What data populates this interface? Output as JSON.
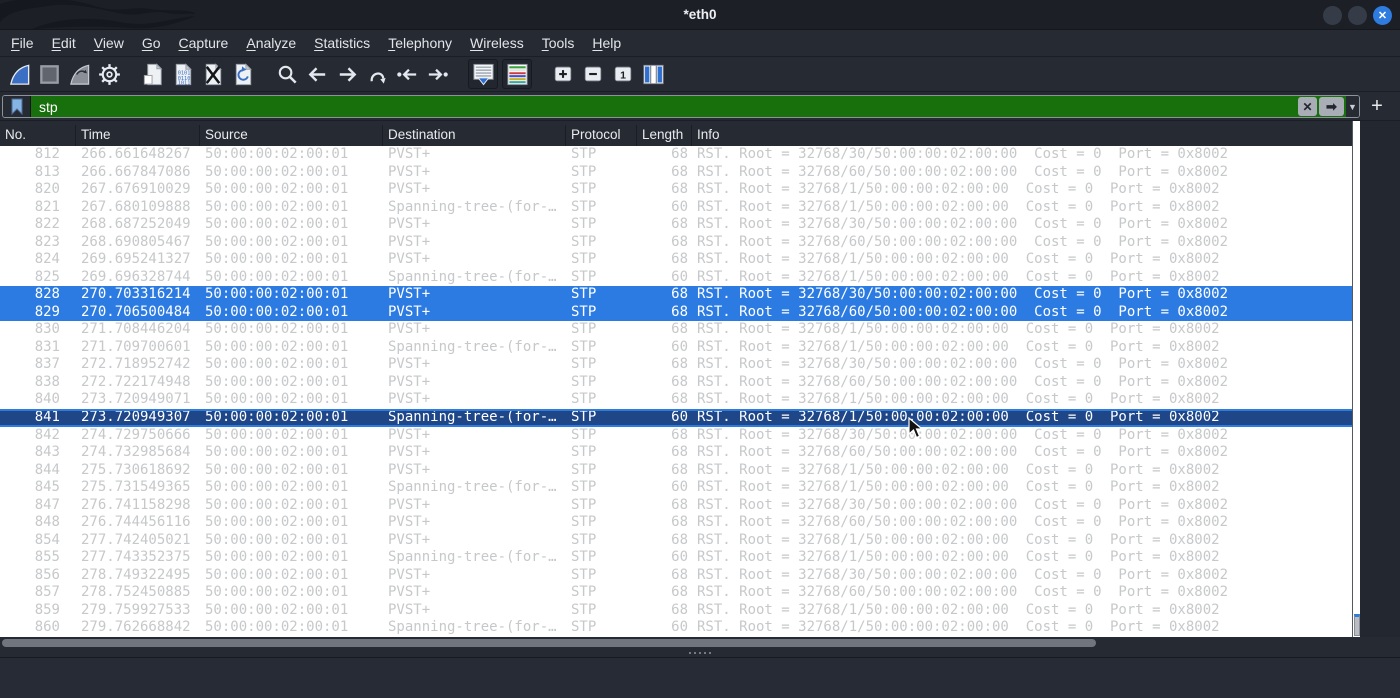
{
  "window": {
    "title": "*eth0"
  },
  "titlebar": {
    "close_glyph": "✕",
    "buttons": [
      "minimize",
      "maximize",
      "close"
    ]
  },
  "menu": {
    "items": [
      "File",
      "Edit",
      "View",
      "Go",
      "Capture",
      "Analyze",
      "Statistics",
      "Telephony",
      "Wireless",
      "Tools",
      "Help"
    ]
  },
  "toolbar": {
    "groups": [
      [
        "start-capture",
        "stop-capture",
        "restart-capture",
        "capture-options"
      ],
      [
        "open-capture-file",
        "save-capture-file",
        "close-capture-file",
        "reload-capture-file"
      ],
      [
        "find-packet",
        "go-back",
        "go-forward",
        "go-to-packet",
        "go-first-packet",
        "go-last-packet"
      ],
      [
        "auto-scroll",
        "colorize-packets"
      ],
      [
        "zoom-in",
        "zoom-out",
        "zoom-original",
        "resize-columns"
      ]
    ]
  },
  "filter": {
    "value": "stp",
    "state": "valid",
    "field_color": "#17700c",
    "clear_glyph": "✕",
    "apply_glyph": "➡",
    "caret_glyph": "▼",
    "add_label": "+"
  },
  "packet_table": {
    "columns": [
      {
        "key": "no",
        "label": "No.",
        "width": 76,
        "align": "right"
      },
      {
        "key": "time",
        "label": "Time",
        "width": 124,
        "align": "left"
      },
      {
        "key": "source",
        "label": "Source",
        "width": 183,
        "align": "left"
      },
      {
        "key": "destination",
        "label": "Destination",
        "width": 183,
        "align": "left"
      },
      {
        "key": "protocol",
        "label": "Protocol",
        "width": 71,
        "align": "left"
      },
      {
        "key": "length",
        "label": "Length",
        "width": 55,
        "align": "right"
      },
      {
        "key": "info",
        "label": "Info",
        "width": null,
        "align": "left"
      }
    ],
    "rows": [
      {
        "state": "normal",
        "no": "812",
        "time": "266.661648267",
        "source": "50:00:00:02:00:01",
        "destination": "PVST+",
        "protocol": "STP",
        "length": "68",
        "info": "RST. Root = 32768/30/50:00:00:02:00:00  Cost = 0  Port = 0x8002"
      },
      {
        "state": "normal",
        "no": "813",
        "time": "266.667847086",
        "source": "50:00:00:02:00:01",
        "destination": "PVST+",
        "protocol": "STP",
        "length": "68",
        "info": "RST. Root = 32768/60/50:00:00:02:00:00  Cost = 0  Port = 0x8002"
      },
      {
        "state": "normal",
        "no": "820",
        "time": "267.676910029",
        "source": "50:00:00:02:00:01",
        "destination": "PVST+",
        "protocol": "STP",
        "length": "68",
        "info": "RST. Root = 32768/1/50:00:00:02:00:00  Cost = 0  Port = 0x8002"
      },
      {
        "state": "normal",
        "no": "821",
        "time": "267.680109888",
        "source": "50:00:00:02:00:01",
        "destination": "Spanning-tree-(for-…",
        "protocol": "STP",
        "length": "60",
        "info": "RST. Root = 32768/1/50:00:00:02:00:00  Cost = 0  Port = 0x8002"
      },
      {
        "state": "normal",
        "no": "822",
        "time": "268.687252049",
        "source": "50:00:00:02:00:01",
        "destination": "PVST+",
        "protocol": "STP",
        "length": "68",
        "info": "RST. Root = 32768/30/50:00:00:02:00:00  Cost = 0  Port = 0x8002"
      },
      {
        "state": "normal",
        "no": "823",
        "time": "268.690805467",
        "source": "50:00:00:02:00:01",
        "destination": "PVST+",
        "protocol": "STP",
        "length": "68",
        "info": "RST. Root = 32768/60/50:00:00:02:00:00  Cost = 0  Port = 0x8002"
      },
      {
        "state": "normal",
        "no": "824",
        "time": "269.695241327",
        "source": "50:00:00:02:00:01",
        "destination": "PVST+",
        "protocol": "STP",
        "length": "68",
        "info": "RST. Root = 32768/1/50:00:00:02:00:00  Cost = 0  Port = 0x8002"
      },
      {
        "state": "normal",
        "no": "825",
        "time": "269.696328744",
        "source": "50:00:00:02:00:01",
        "destination": "Spanning-tree-(for-…",
        "protocol": "STP",
        "length": "60",
        "info": "RST. Root = 32768/1/50:00:00:02:00:00  Cost = 0  Port = 0x8002"
      },
      {
        "state": "selected",
        "no": "828",
        "time": "270.703316214",
        "source": "50:00:00:02:00:01",
        "destination": "PVST+",
        "protocol": "STP",
        "length": "68",
        "info": "RST. Root = 32768/30/50:00:00:02:00:00  Cost = 0  Port = 0x8002"
      },
      {
        "state": "selected",
        "no": "829",
        "time": "270.706500484",
        "source": "50:00:00:02:00:01",
        "destination": "PVST+",
        "protocol": "STP",
        "length": "68",
        "info": "RST. Root = 32768/60/50:00:00:02:00:00  Cost = 0  Port = 0x8002"
      },
      {
        "state": "normal",
        "no": "830",
        "time": "271.708446204",
        "source": "50:00:00:02:00:01",
        "destination": "PVST+",
        "protocol": "STP",
        "length": "68",
        "info": "RST. Root = 32768/1/50:00:00:02:00:00  Cost = 0  Port = 0x8002"
      },
      {
        "state": "normal",
        "no": "831",
        "time": "271.709700601",
        "source": "50:00:00:02:00:01",
        "destination": "Spanning-tree-(for-…",
        "protocol": "STP",
        "length": "60",
        "info": "RST. Root = 32768/1/50:00:00:02:00:00  Cost = 0  Port = 0x8002"
      },
      {
        "state": "normal",
        "no": "837",
        "time": "272.718952742",
        "source": "50:00:00:02:00:01",
        "destination": "PVST+",
        "protocol": "STP",
        "length": "68",
        "info": "RST. Root = 32768/30/50:00:00:02:00:00  Cost = 0  Port = 0x8002"
      },
      {
        "state": "normal",
        "no": "838",
        "time": "272.722174948",
        "source": "50:00:00:02:00:01",
        "destination": "PVST+",
        "protocol": "STP",
        "length": "68",
        "info": "RST. Root = 32768/60/50:00:00:02:00:00  Cost = 0  Port = 0x8002"
      },
      {
        "state": "normal",
        "no": "840",
        "time": "273.720949071",
        "source": "50:00:00:02:00:01",
        "destination": "PVST+",
        "protocol": "STP",
        "length": "68",
        "info": "RST. Root = 32768/1/50:00:00:02:00:00  Cost = 0  Port = 0x8002"
      },
      {
        "state": "focused",
        "no": "841",
        "time": "273.720949307",
        "source": "50:00:00:02:00:01",
        "destination": "Spanning-tree-(for-…",
        "protocol": "STP",
        "length": "60",
        "info": "RST. Root = 32768/1/50:00:00:02:00:00  Cost = 0  Port = 0x8002"
      },
      {
        "state": "normal",
        "no": "842",
        "time": "274.729750666",
        "source": "50:00:00:02:00:01",
        "destination": "PVST+",
        "protocol": "STP",
        "length": "68",
        "info": "RST. Root = 32768/30/50:00:00:02:00:00  Cost = 0  Port = 0x8002"
      },
      {
        "state": "normal",
        "no": "843",
        "time": "274.732985684",
        "source": "50:00:00:02:00:01",
        "destination": "PVST+",
        "protocol": "STP",
        "length": "68",
        "info": "RST. Root = 32768/60/50:00:00:02:00:00  Cost = 0  Port = 0x8002"
      },
      {
        "state": "normal",
        "no": "844",
        "time": "275.730618692",
        "source": "50:00:00:02:00:01",
        "destination": "PVST+",
        "protocol": "STP",
        "length": "68",
        "info": "RST. Root = 32768/1/50:00:00:02:00:00  Cost = 0  Port = 0x8002"
      },
      {
        "state": "normal",
        "no": "845",
        "time": "275.731549365",
        "source": "50:00:00:02:00:01",
        "destination": "Spanning-tree-(for-…",
        "protocol": "STP",
        "length": "60",
        "info": "RST. Root = 32768/1/50:00:00:02:00:00  Cost = 0  Port = 0x8002"
      },
      {
        "state": "normal",
        "no": "847",
        "time": "276.741158298",
        "source": "50:00:00:02:00:01",
        "destination": "PVST+",
        "protocol": "STP",
        "length": "68",
        "info": "RST. Root = 32768/30/50:00:00:02:00:00  Cost = 0  Port = 0x8002"
      },
      {
        "state": "normal",
        "no": "848",
        "time": "276.744456116",
        "source": "50:00:00:02:00:01",
        "destination": "PVST+",
        "protocol": "STP",
        "length": "68",
        "info": "RST. Root = 32768/60/50:00:00:02:00:00  Cost = 0  Port = 0x8002"
      },
      {
        "state": "normal",
        "no": "854",
        "time": "277.742405021",
        "source": "50:00:00:02:00:01",
        "destination": "PVST+",
        "protocol": "STP",
        "length": "68",
        "info": "RST. Root = 32768/1/50:00:00:02:00:00  Cost = 0  Port = 0x8002"
      },
      {
        "state": "normal",
        "no": "855",
        "time": "277.743352375",
        "source": "50:00:00:02:00:01",
        "destination": "Spanning-tree-(for-…",
        "protocol": "STP",
        "length": "60",
        "info": "RST. Root = 32768/1/50:00:00:02:00:00  Cost = 0  Port = 0x8002"
      },
      {
        "state": "normal",
        "no": "856",
        "time": "278.749322495",
        "source": "50:00:00:02:00:01",
        "destination": "PVST+",
        "protocol": "STP",
        "length": "68",
        "info": "RST. Root = 32768/30/50:00:00:02:00:00  Cost = 0  Port = 0x8002"
      },
      {
        "state": "normal",
        "no": "857",
        "time": "278.752450885",
        "source": "50:00:00:02:00:01",
        "destination": "PVST+",
        "protocol": "STP",
        "length": "68",
        "info": "RST. Root = 32768/60/50:00:00:02:00:00  Cost = 0  Port = 0x8002"
      },
      {
        "state": "normal",
        "no": "859",
        "time": "279.759927533",
        "source": "50:00:00:02:00:01",
        "destination": "PVST+",
        "protocol": "STP",
        "length": "68",
        "info": "RST. Root = 32768/1/50:00:00:02:00:00  Cost = 0  Port = 0x8002"
      },
      {
        "state": "normal",
        "no": "860",
        "time": "279.762668842",
        "source": "50:00:00:02:00:01",
        "destination": "Spanning-tree-(for-…",
        "protocol": "STP",
        "length": "60",
        "info": "RST. Root = 32768/1/50:00:00:02:00:00  Cost = 0  Port = 0x8002"
      }
    ]
  },
  "colors": {
    "selected_row": "#2c7be2",
    "focused_row": "#1f4687",
    "filter_valid_green": "#17700c",
    "accent_blue": "#2e7ce0",
    "row_text_grey": "#c6c8ca"
  }
}
